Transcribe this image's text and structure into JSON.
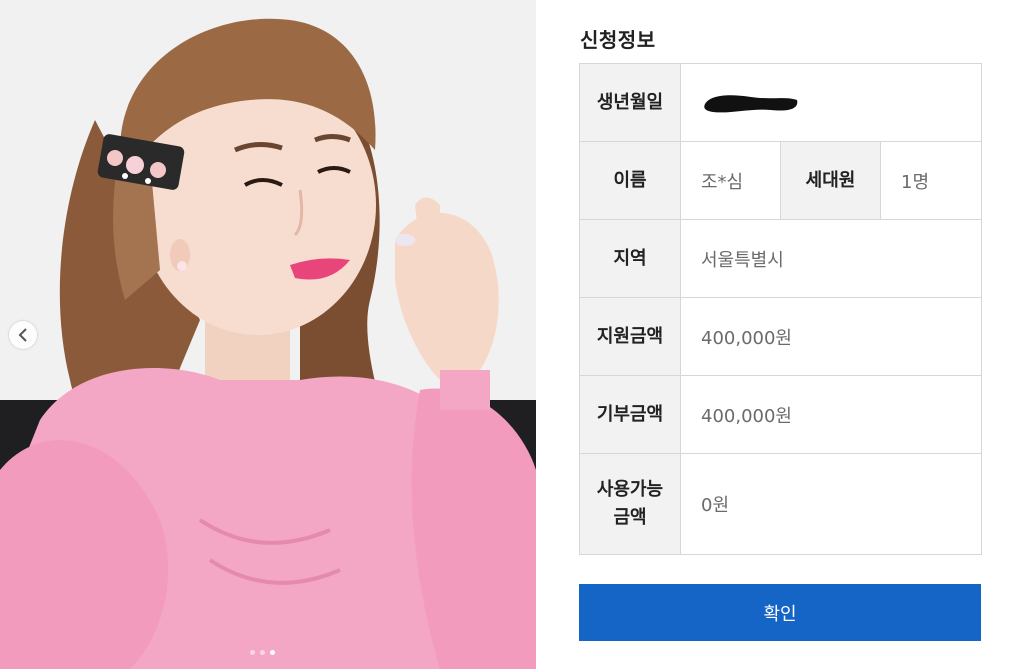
{
  "photo": {
    "carousel_dots": 3,
    "active_dot": 2
  },
  "form": {
    "section_title": "신청정보",
    "rows": {
      "birth": {
        "label": "생년월일",
        "value": ""
      },
      "name": {
        "label": "이름",
        "value": "조*심"
      },
      "household": {
        "label": "세대원",
        "value": "1명"
      },
      "region": {
        "label": "지역",
        "value": "서울특별시"
      },
      "support_amount": {
        "label": "지원금액",
        "value": "400,000원"
      },
      "donation_amount": {
        "label": "기부금액",
        "value": "400,000원"
      },
      "available_amount": {
        "label_line1": "사용가능",
        "label_line2": "금액",
        "value": "0원"
      }
    },
    "confirm_label": "확인"
  },
  "colors": {
    "header_cell_bg": "#f2f2f2",
    "border": "#d7d7d7",
    "button_bg": "#1565c7",
    "shirt_pink": "#f4a7c4"
  }
}
